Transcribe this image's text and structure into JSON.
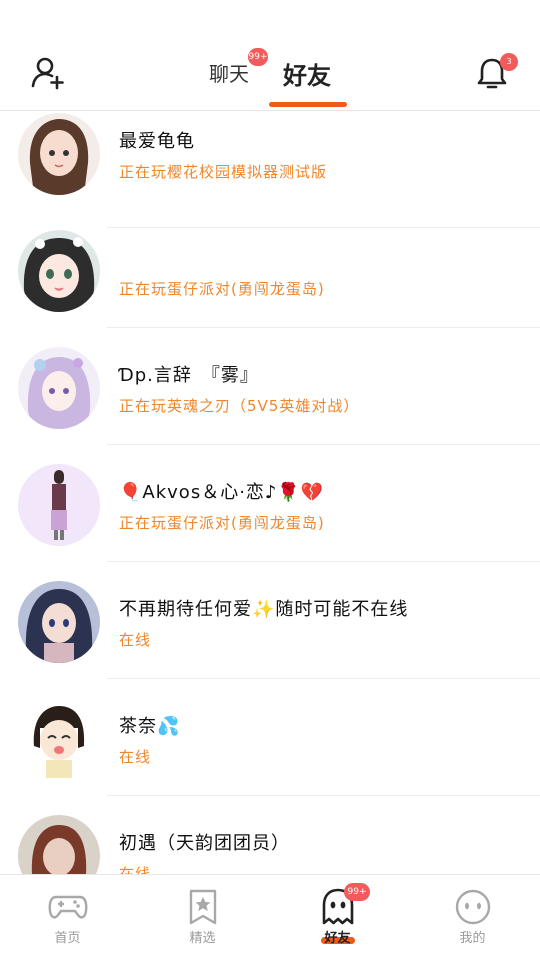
{
  "header": {
    "tab_chat": "聊天",
    "tab_friends": "好友",
    "chat_badge": "99+",
    "bell_badge": "3",
    "add_friend_icon": "add-user-icon",
    "bell_icon": "bell-icon"
  },
  "friends": [
    {
      "name": "最爱龟龟",
      "status": "正在玩樱花校园模拟器测试版"
    },
    {
      "name": "",
      "status": "正在玩蛋仔派对(勇闯龙蛋岛)"
    },
    {
      "name": "Ɗp.言辞　『雾』",
      "status": "正在玩英魂之刃（5V5英雄对战）"
    },
    {
      "name": "🎈Akvos＆心·恋♪🌹💔",
      "status": "正在玩蛋仔派对(勇闯龙蛋岛)"
    },
    {
      "name": "不再期待任何爱✨随时可能不在线",
      "status": "在线"
    },
    {
      "name": "茶奈💦",
      "status": "在线"
    },
    {
      "name": "初遇（天韵团团员）",
      "status": "在线"
    }
  ],
  "tabbar": {
    "items": [
      {
        "label": "首页",
        "icon": "gamepad-icon"
      },
      {
        "label": "精选",
        "icon": "star-bookmark-icon"
      },
      {
        "label": "好友",
        "icon": "ghost-icon"
      },
      {
        "label": "我的",
        "icon": "face-icon"
      }
    ],
    "friends_badge": "99+"
  },
  "colors": {
    "accent": "#f05a1a",
    "status": "#f0872c",
    "badge": "#f25b5b"
  }
}
